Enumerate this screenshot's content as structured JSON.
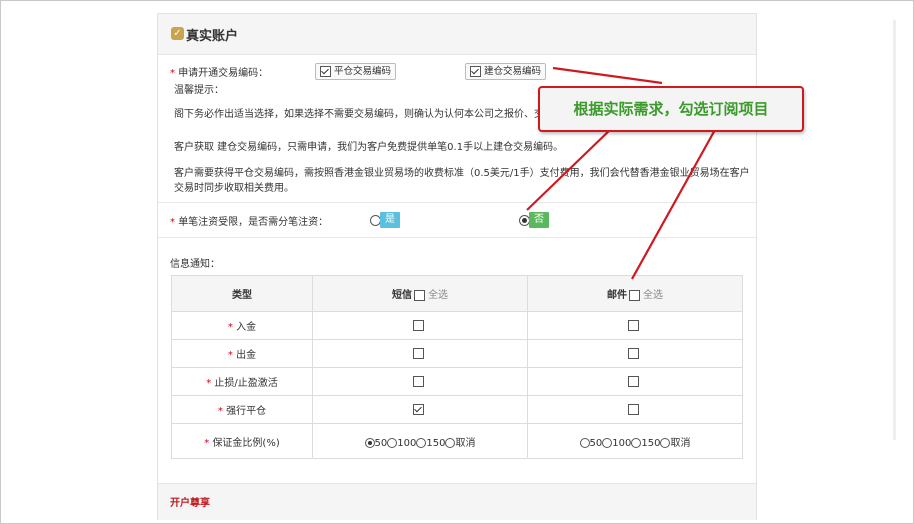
{
  "panel": {
    "title": "真实账户",
    "apply_label": "申请开通交易编码：",
    "ping_label": "平仓交易编码",
    "jian_label": "建仓交易编码",
    "tips_title": "温馨提示：",
    "tip1": "阁下务必作出适当选择，如果选择不需要交易编码，则确认为认何本公司之报价、交",
    "tip2": "客户获取 建仓交易编码，只需申请，我们为客户免费提供单笔0.1手以上建仓交易编码。",
    "tip3a": "客户需要获得平仓交易编码，需按照香港金银业贸易场的收费标准（0.5美元/1手）支付费用，我们会代替香港金银业贸易场在客户",
    "tip3b": "交易时同步收取相关费用。",
    "limit_label": "单笔注资受限，是否需分笔注资：",
    "yes": "是",
    "no": "否",
    "notify_label": "信息通知：",
    "footer_label": "开户尊享"
  },
  "table": {
    "h_type": "类型",
    "h_sms": "短信",
    "h_mail": "邮件",
    "select_all": "全选",
    "rows": [
      {
        "label": "入金",
        "sms": false,
        "mail": false
      },
      {
        "label": "出金",
        "sms": false,
        "mail": false
      },
      {
        "label": "止损/止盈激活",
        "sms": false,
        "mail": false
      },
      {
        "label": "强行平仓",
        "sms": true,
        "mail": false
      }
    ],
    "margin_label": "保证金比例(%)",
    "opt_50": "50",
    "opt_100": "100",
    "opt_150": "150",
    "opt_cancel": "取消"
  },
  "callout": {
    "text": "根据实际需求，勾选订阅项目"
  },
  "colors": {
    "accent_red": "#d0191f",
    "callout_green": "#3a9a2a",
    "yes_blue": "#5bc0de",
    "no_green": "#5cb85c",
    "title_gold": "#c9a44f"
  }
}
